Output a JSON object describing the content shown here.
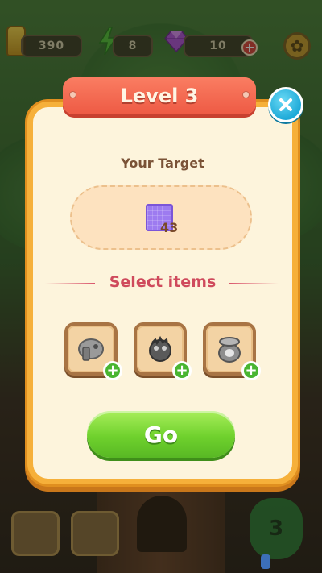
{
  "hud": {
    "coins": "390",
    "energy": "8",
    "gems": "10",
    "gems_plus": "+"
  },
  "dialog": {
    "title": "Level 3",
    "target_label": "Your Target",
    "target_count": "43",
    "select_label": "Select items",
    "items": [
      {
        "icon": "hammer-booster-icon",
        "add": "+"
      },
      {
        "icon": "bomb-booster-icon",
        "add": "+"
      },
      {
        "icon": "pot-booster-icon",
        "add": "+"
      }
    ],
    "go_label": "Go"
  },
  "background": {
    "moves_number": "3"
  },
  "colors": {
    "frame": "#f6b03a",
    "banner": "#ee5a44",
    "go": "#6fd12d",
    "close": "#1faad8",
    "target_tile": "#9d7bf0",
    "select_text": "#cf4a5c"
  }
}
